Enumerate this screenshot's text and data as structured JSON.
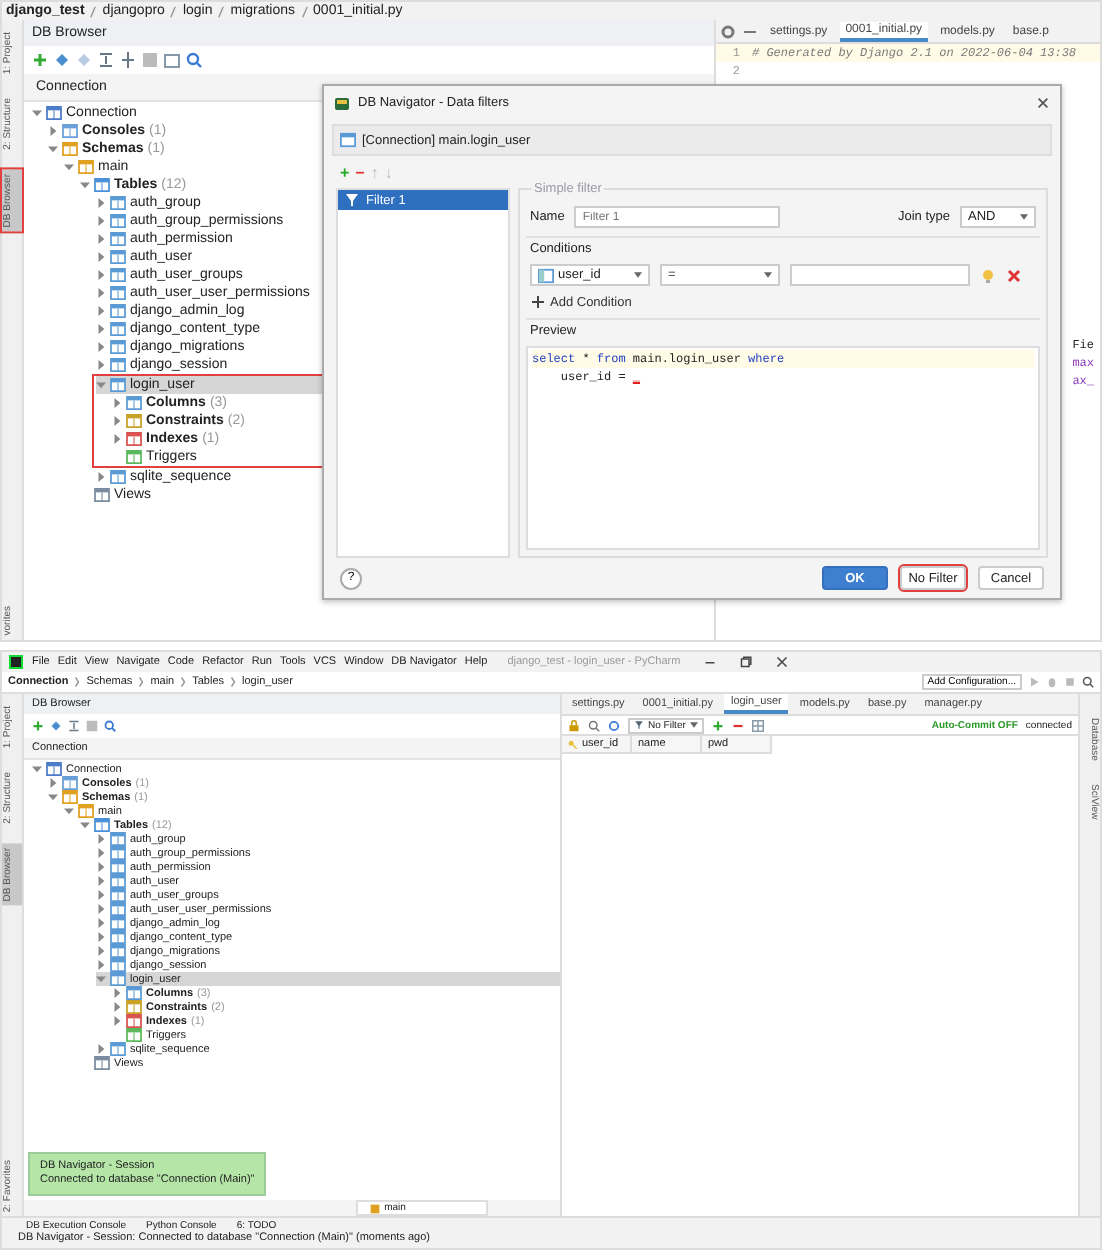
{
  "top": {
    "breadcrumb": [
      "django_test",
      "djangopro",
      "login",
      "migrations",
      "0001_initial.py"
    ],
    "side_tabs": [
      {
        "label": "1: Project",
        "selected": false,
        "annotated": false
      },
      {
        "label": "2: Structure",
        "selected": false,
        "annotated": false
      },
      {
        "label": "DB Browser",
        "selected": true,
        "annotated": true
      },
      {
        "label": "vorites",
        "selected": false,
        "annotated": false
      }
    ],
    "panel_title": "DB Browser",
    "tree_header": "Connection",
    "tree": [
      {
        "kind": "connection",
        "label": "Connection",
        "expanded": true,
        "selected": false,
        "children": [
          {
            "kind": "consoles",
            "label": "Consoles",
            "count": "(1)",
            "expanded": false,
            "selected": false
          },
          {
            "kind": "schemas",
            "label": "Schemas",
            "count": "(1)",
            "expanded": true,
            "selected": false,
            "children": [
              {
                "kind": "schema",
                "label": "main",
                "expanded": true,
                "selected": false,
                "children": [
                  {
                    "kind": "tables",
                    "label": "Tables",
                    "count": "(12)",
                    "expanded": true,
                    "selected": false,
                    "children": [
                      {
                        "kind": "table",
                        "label": "auth_group",
                        "expanded": false,
                        "selected": false
                      },
                      {
                        "kind": "table",
                        "label": "auth_group_permissions",
                        "expanded": false,
                        "selected": false
                      },
                      {
                        "kind": "table",
                        "label": "auth_permission",
                        "expanded": false,
                        "selected": false
                      },
                      {
                        "kind": "table",
                        "label": "auth_user",
                        "expanded": false,
                        "selected": false
                      },
                      {
                        "kind": "table",
                        "label": "auth_user_groups",
                        "expanded": false,
                        "selected": false
                      },
                      {
                        "kind": "table",
                        "label": "auth_user_user_permissions",
                        "expanded": false,
                        "selected": false
                      },
                      {
                        "kind": "table",
                        "label": "django_admin_log",
                        "expanded": false,
                        "selected": false
                      },
                      {
                        "kind": "table",
                        "label": "django_content_type",
                        "expanded": false,
                        "selected": false
                      },
                      {
                        "kind": "table",
                        "label": "django_migrations",
                        "expanded": false,
                        "selected": false
                      },
                      {
                        "kind": "table",
                        "label": "django_session",
                        "expanded": false,
                        "selected": false
                      },
                      {
                        "kind": "table",
                        "label": "login_user",
                        "expanded": true,
                        "selected": true,
                        "annotated": true,
                        "children": [
                          {
                            "kind": "columns",
                            "label": "Columns",
                            "count": "(3)",
                            "expanded": false,
                            "selected": false
                          },
                          {
                            "kind": "constraints",
                            "label": "Constraints",
                            "count": "(2)",
                            "expanded": false,
                            "selected": false
                          },
                          {
                            "kind": "indexes",
                            "label": "Indexes",
                            "count": "(1)",
                            "expanded": false,
                            "selected": false
                          },
                          {
                            "kind": "triggers",
                            "label": "Triggers",
                            "selected": false
                          }
                        ]
                      },
                      {
                        "kind": "table",
                        "label": "sqlite_sequence",
                        "expanded": false,
                        "selected": false
                      }
                    ]
                  },
                  {
                    "kind": "views",
                    "label": "Views",
                    "selected": false
                  }
                ]
              }
            ]
          }
        ]
      }
    ],
    "editor_tabs": [
      {
        "label": "settings.py",
        "selected": false
      },
      {
        "label": "0001_initial.py",
        "selected": true
      },
      {
        "label": "models.py",
        "selected": false
      },
      {
        "label": "base.p",
        "selected": false
      }
    ],
    "code_lines": [
      {
        "number": "1",
        "text": "# Generated by Django 2.1 on 2022-06-04 13:38"
      },
      {
        "number": "2"
      }
    ],
    "code_fragments": [
      {
        "text": "Fie",
        "kind": "plain"
      },
      {
        "text": "max",
        "kind": "keyword"
      },
      {
        "text": "ax_",
        "kind": "keyword"
      }
    ],
    "dialog": {
      "title": "DB Navigator - Data filters",
      "subject": "[Connection] main.login_user",
      "list_tools": [
        {
          "text": "+",
          "kind": "add"
        },
        {
          "text": "−",
          "kind": "remove"
        },
        {
          "text": "↑",
          "kind": "move"
        },
        {
          "text": "↓",
          "kind": "move"
        }
      ],
      "filters": [
        {
          "label": "Filter 1",
          "selected": true
        }
      ],
      "group_title": "Simple filter",
      "name_label": "Name",
      "name_placeholder": "Filter 1",
      "join_label": "Join type",
      "join_value": "AND",
      "conditions_label": "Conditions",
      "condition": {
        "column": "user_id",
        "operator": "="
      },
      "add_condition": "Add Condition",
      "preview_label": "Preview",
      "preview_lines": [
        [
          {
            "text": "select",
            "kind": "keyword"
          },
          {
            "text": " * ",
            "kind": "plain"
          },
          {
            "text": "from",
            "kind": "keyword"
          },
          {
            "text": " main.login_user ",
            "kind": "plain"
          },
          {
            "text": "where",
            "kind": "keyword"
          }
        ],
        [
          {
            "text": "    user_id = ",
            "kind": "plain"
          },
          {
            "text": "_",
            "kind": "error"
          }
        ]
      ],
      "help": "?",
      "buttons": [
        {
          "label": "OK",
          "kind": "primary",
          "annotated": false
        },
        {
          "label": "No Filter",
          "kind": "normal",
          "annotated": true
        },
        {
          "label": "Cancel",
          "kind": "normal",
          "annotated": false
        }
      ]
    }
  },
  "bottom": {
    "menu": [
      "File",
      "Edit",
      "View",
      "Navigate",
      "Code",
      "Refactor",
      "Run",
      "Tools",
      "VCS",
      "Window",
      "DB Navigator",
      "Help"
    ],
    "window_title": "django_test - login_user - PyCharm",
    "breadcrumb": [
      "Connection",
      "Schemas",
      "main",
      "Tables",
      "login_user"
    ],
    "run_config": "Add Configuration...",
    "side_tabs": [
      {
        "label": "1: Project",
        "selected": false,
        "annotated": false
      },
      {
        "label": "2: Structure",
        "selected": false,
        "annotated": false
      },
      {
        "label": "DB Browser",
        "selected": true,
        "annotated": false
      },
      {
        "label": "2: Favorites",
        "selected": false,
        "annotated": false
      }
    ],
    "right_tabs": [
      {
        "label": "Database"
      },
      {
        "label": "SciView"
      }
    ],
    "panel_title": "DB Browser",
    "tree_header": "Connection",
    "tree": [
      {
        "kind": "connection",
        "label": "Connection",
        "expanded": true,
        "selected": false,
        "children": [
          {
            "kind": "consoles",
            "label": "Consoles",
            "count": "(1)",
            "expanded": false,
            "selected": false
          },
          {
            "kind": "schemas",
            "label": "Schemas",
            "count": "(1)",
            "expanded": true,
            "selected": false,
            "children": [
              {
                "kind": "schema",
                "label": "main",
                "expanded": true,
                "selected": false,
                "children": [
                  {
                    "kind": "tables",
                    "label": "Tables",
                    "count": "(12)",
                    "expanded": true,
                    "selected": false,
                    "children": [
                      {
                        "kind": "table",
                        "label": "auth_group",
                        "expanded": false,
                        "selected": false
                      },
                      {
                        "kind": "table",
                        "label": "auth_group_permissions",
                        "expanded": false,
                        "selected": false
                      },
                      {
                        "kind": "table",
                        "label": "auth_permission",
                        "expanded": false,
                        "selected": false
                      },
                      {
                        "kind": "table",
                        "label": "auth_user",
                        "expanded": false,
                        "selected": false
                      },
                      {
                        "kind": "table",
                        "label": "auth_user_groups",
                        "expanded": false,
                        "selected": false
                      },
                      {
                        "kind": "table",
                        "label": "auth_user_user_permissions",
                        "expanded": false,
                        "selected": false
                      },
                      {
                        "kind": "table",
                        "label": "django_admin_log",
                        "expanded": false,
                        "selected": false
                      },
                      {
                        "kind": "table",
                        "label": "django_content_type",
                        "expanded": false,
                        "selected": false
                      },
                      {
                        "kind": "table",
                        "label": "django_migrations",
                        "expanded": false,
                        "selected": false
                      },
                      {
                        "kind": "table",
                        "label": "django_session",
                        "expanded": false,
                        "selected": false
                      },
                      {
                        "kind": "table",
                        "label": "login_user",
                        "expanded": true,
                        "selected": true,
                        "annotated": false,
                        "children": [
                          {
                            "kind": "columns",
                            "label": "Columns",
                            "count": "(3)",
                            "expanded": false,
                            "selected": false
                          },
                          {
                            "kind": "constraints",
                            "label": "Constraints",
                            "count": "(2)",
                            "expanded": false,
                            "selected": false
                          },
                          {
                            "kind": "indexes",
                            "label": "Indexes",
                            "count": "(1)",
                            "expanded": false,
                            "selected": false
                          },
                          {
                            "kind": "triggers",
                            "label": "Triggers",
                            "selected": false
                          }
                        ]
                      },
                      {
                        "kind": "table",
                        "label": "sqlite_sequence",
                        "expanded": false,
                        "selected": false
                      }
                    ]
                  },
                  {
                    "kind": "views",
                    "label": "Views",
                    "selected": false
                  }
                ]
              }
            ]
          }
        ]
      }
    ],
    "editor_tabs": [
      {
        "label": "settings.py",
        "selected": false
      },
      {
        "label": "0001_initial.py",
        "selected": false
      },
      {
        "label": "login_user",
        "selected": true
      },
      {
        "label": "models.py",
        "selected": false
      },
      {
        "label": "base.py",
        "selected": false
      },
      {
        "label": "manager.py",
        "selected": false
      }
    ],
    "filter": "No Filter",
    "commit_status": "Auto-Commit OFF",
    "connection_status": "connected",
    "columns": [
      "user_id",
      "name",
      "pwd"
    ],
    "schema_field": "main",
    "notification": {
      "title": "DB Navigator - Session",
      "message": "Connected to database \"Connection (Main)\""
    },
    "tool_tabs": [
      "DB Execution Console",
      "Python Console",
      "6: TODO"
    ],
    "status": "DB Navigator - Session: Connected to database \"Connection (Main)\" (moments ago)"
  }
}
